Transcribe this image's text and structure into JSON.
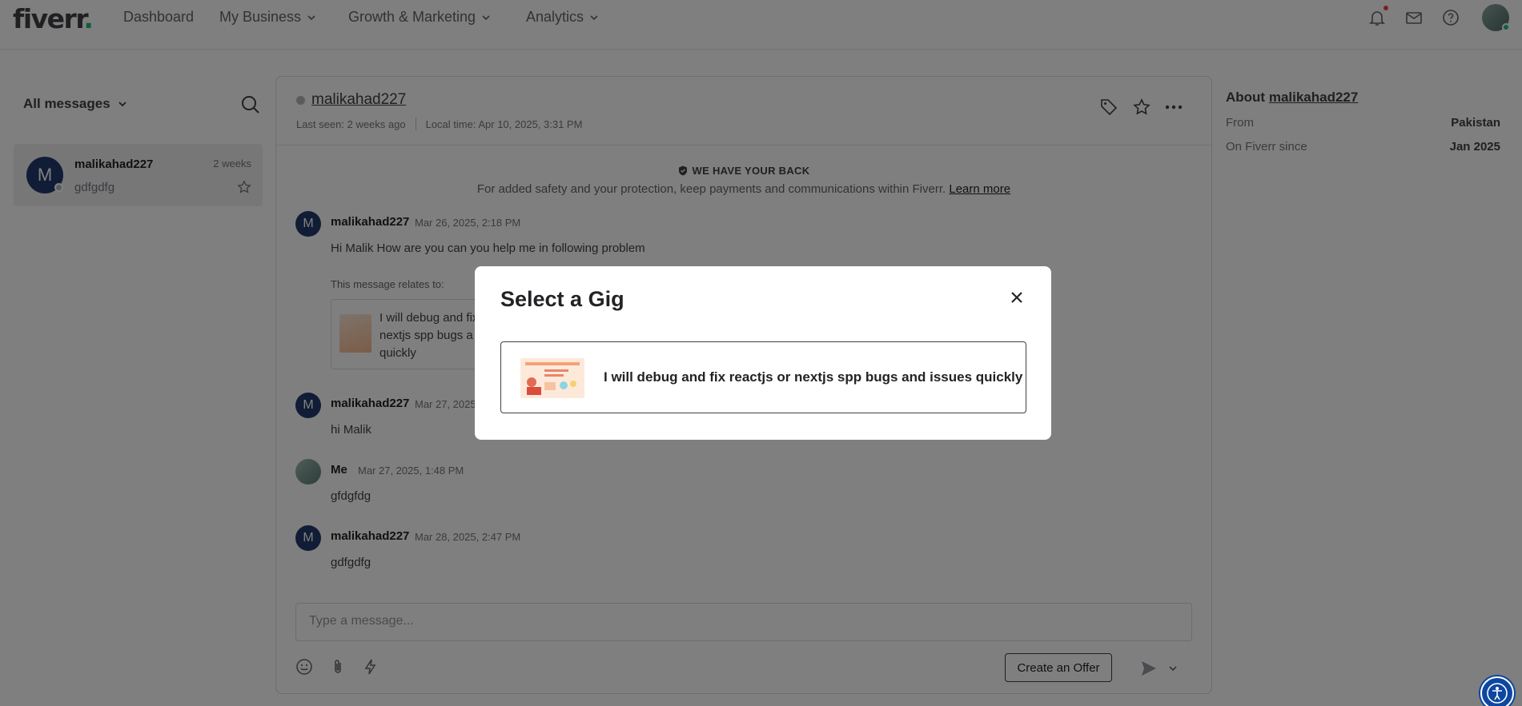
{
  "topnav": {
    "logo": "fiverr",
    "logo_dot": ".",
    "items": [
      {
        "label": "Dashboard"
      },
      {
        "label": "My Business"
      },
      {
        "label": "Growth & Marketing"
      },
      {
        "label": "Analytics"
      }
    ],
    "icons": [
      "bell-icon",
      "mail-icon",
      "help-icon"
    ],
    "notification_dot_color": "#f74040"
  },
  "sidebar": {
    "filter_label": "All messages",
    "conversations": [
      {
        "avatar_letter": "M",
        "name": "malikahad227",
        "time": "2 weeks",
        "preview": "gdfgdfg"
      }
    ]
  },
  "chat": {
    "username": "malikahad227",
    "last_seen": "Last seen: 2 weeks ago",
    "local_time": "Local time: Apr 10, 2025, 3:31 PM",
    "safety_title": "WE HAVE YOUR BACK",
    "safety_text": "For added safety and your protection, keep payments and communications within Fiverr.",
    "safety_link": "Learn more",
    "messages": [
      {
        "avatar_letter": "M",
        "sender": "malikahad227",
        "time": "Mar 26, 2025, 2:18 PM",
        "text": "Hi Malik How are you can you help me in following problem"
      },
      {
        "avatar_letter": "M",
        "sender": "malikahad227",
        "time": "Mar 27, 2025,",
        "text": "hi Malik"
      },
      {
        "avatar_letter": "",
        "sender": "Me",
        "time": "Mar 27, 2025, 1:48 PM",
        "text": "gfdgfdg"
      },
      {
        "avatar_letter": "M",
        "sender": "malikahad227",
        "time": "Mar 28, 2025, 2:47 PM",
        "text": "gdfgdfg"
      }
    ],
    "relates_label": "This message relates to:",
    "related_gig_text": "I will debug and fix nextjs spp bugs a quickly",
    "composer_placeholder": "Type a message...",
    "offer_button": "Create an Offer"
  },
  "about": {
    "title_prefix": "About",
    "username": "malikahad227",
    "rows": [
      {
        "label": "From",
        "value": "Pakistan"
      },
      {
        "label": "On Fiverr since",
        "value": "Jan 2025"
      }
    ]
  },
  "modal": {
    "title": "Select a Gig",
    "gig_option": "I will debug and fix reactjs or nextjs spp bugs and issues quickly"
  },
  "colors": {
    "brand_green": "#1dbf73",
    "avatar_navy": "#223a6e",
    "overlay": "rgba(0,0,0,0.5)"
  }
}
